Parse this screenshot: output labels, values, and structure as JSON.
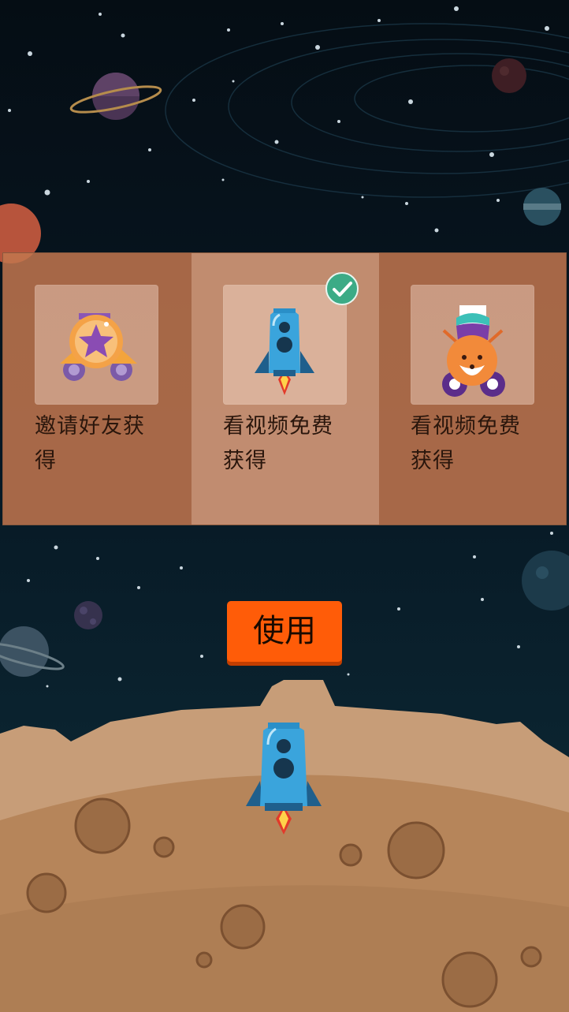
{
  "ship_options": [
    {
      "label": "邀请好友获得",
      "icon": "star-cart-ship-icon",
      "selected": false
    },
    {
      "label": "看视频免费获得",
      "icon": "blue-rocket-icon",
      "selected": true
    },
    {
      "label": "看视频免费获得",
      "icon": "fox-cart-ship-icon",
      "selected": false
    }
  ],
  "use_button_label": "使用",
  "current_ship": "blue-rocket-icon",
  "colors": {
    "accent": "#ff5c08",
    "check": "#3cab86",
    "panel": "#c1764e"
  }
}
